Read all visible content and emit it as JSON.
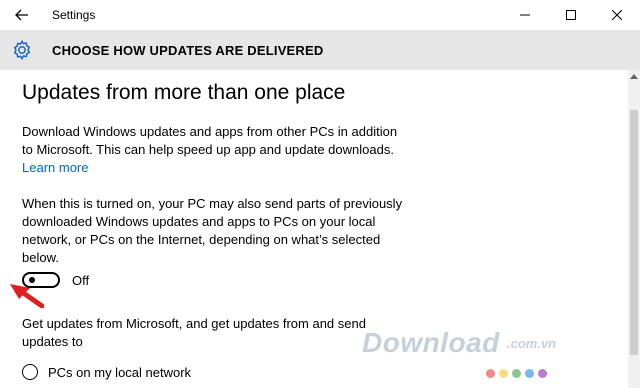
{
  "window": {
    "title": "Settings"
  },
  "header": {
    "title": "CHOOSE HOW UPDATES ARE DELIVERED"
  },
  "main": {
    "heading": "Updates from more than one place",
    "paragraph1_lines": [
      "Download Windows updates and apps from other PCs in addition",
      "to Microsoft. This can help speed up app and update downloads."
    ],
    "learn_more": "Learn more",
    "paragraph2_lines": [
      "When this is turned on, your PC may also send parts of previously",
      "downloaded Windows updates and apps to PCs on your local",
      "network, or PCs on the Internet, depending on what’s selected",
      "below."
    ],
    "toggle_state": "Off",
    "paragraph3_lines": [
      "Get updates from Microsoft, and get updates from and send",
      "updates to"
    ],
    "radio_option": "PCs on my local network"
  },
  "watermark": {
    "text": "Download",
    "suffix": ".com.vn",
    "dot_colors": [
      "#e53935",
      "#fbc02d",
      "#43a047",
      "#1e88e5",
      "#8e24aa"
    ]
  },
  "icons": {
    "back": "back-arrow-icon",
    "gear": "gear-icon",
    "minimize": "minimize-icon",
    "maximize": "maximize-icon",
    "close": "close-icon"
  },
  "colors": {
    "header_bg": "#e6e6e6",
    "link": "#0066cc",
    "annotation_arrow": "#e02020"
  }
}
